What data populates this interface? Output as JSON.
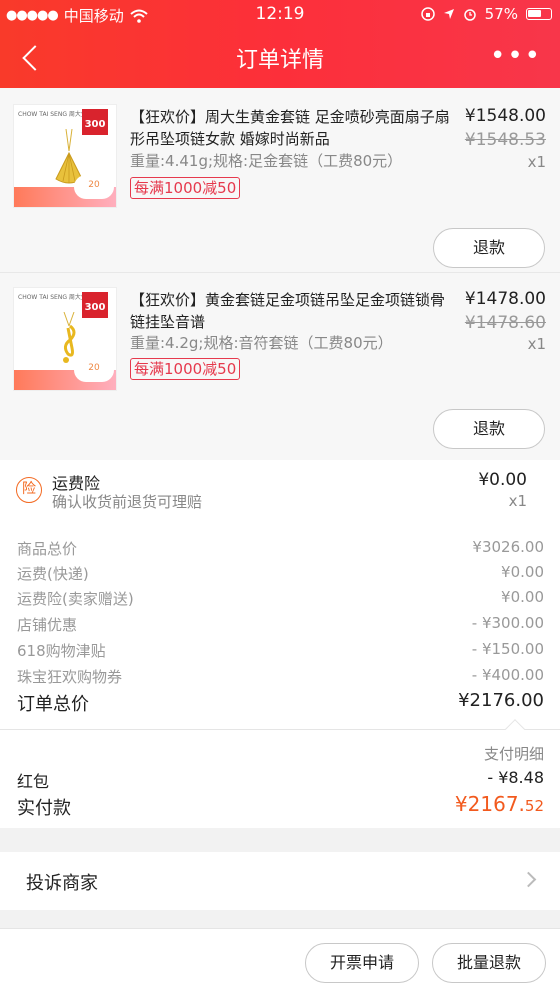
{
  "status": {
    "signal": "●●●●●",
    "carrier": "中国移动",
    "time": "12:19",
    "battery": "57%"
  },
  "header": {
    "title": "订单详情",
    "more": "•••"
  },
  "products": [
    {
      "name": "【狂欢价】周大生黄金套链 足金喷砂亮面扇子扇形吊坠项链女款 婚嫁时尚新品",
      "spec": "重量:4.41g;规格:足金套链（工费80元）",
      "promo": "每满1000减50",
      "price": "¥1548.00",
      "orig": "¥1548.53",
      "qty": "x1",
      "refund": "退款"
    },
    {
      "name": "【狂欢价】黄金套链足金项链吊坠足金项链锁骨链挂坠音谱",
      "spec": "重量:4.2g;规格:音符套链（工费80元）",
      "promo": "每满1000减50",
      "price": "¥1478.00",
      "orig": "¥1478.60",
      "qty": "x1",
      "refund": "退款"
    }
  ],
  "insurance": {
    "icon": "险",
    "title": "运费险",
    "sub": "确认收货前退货可理赔",
    "price": "¥0.00",
    "qty": "x1"
  },
  "summary": [
    {
      "label": "商品总价",
      "value": "¥3026.00"
    },
    {
      "label": "运费(快递)",
      "value": "¥0.00"
    },
    {
      "label": "运费险(卖家赠送)",
      "value": "¥0.00"
    },
    {
      "label": "店铺优惠",
      "value": "- ¥300.00"
    },
    {
      "label": "618购物津贴",
      "value": "- ¥150.00"
    },
    {
      "label": "珠宝狂欢购物券",
      "value": "- ¥400.00"
    }
  ],
  "order_total": {
    "label": "订单总价",
    "value": "¥2176.00"
  },
  "pay_detail": "支付明细",
  "red_envelope": {
    "label": "红包",
    "value": "- ¥8.48"
  },
  "paid": {
    "label": "实付款",
    "value_main": "¥2167.",
    "value_cents": "52"
  },
  "complain": "投诉商家",
  "bottom": {
    "invoice": "开票申请",
    "batch_refund": "批量退款"
  },
  "colors": {
    "header": "#fc2f3a",
    "accent": "#f25a1e",
    "promo": "#e6394d"
  }
}
